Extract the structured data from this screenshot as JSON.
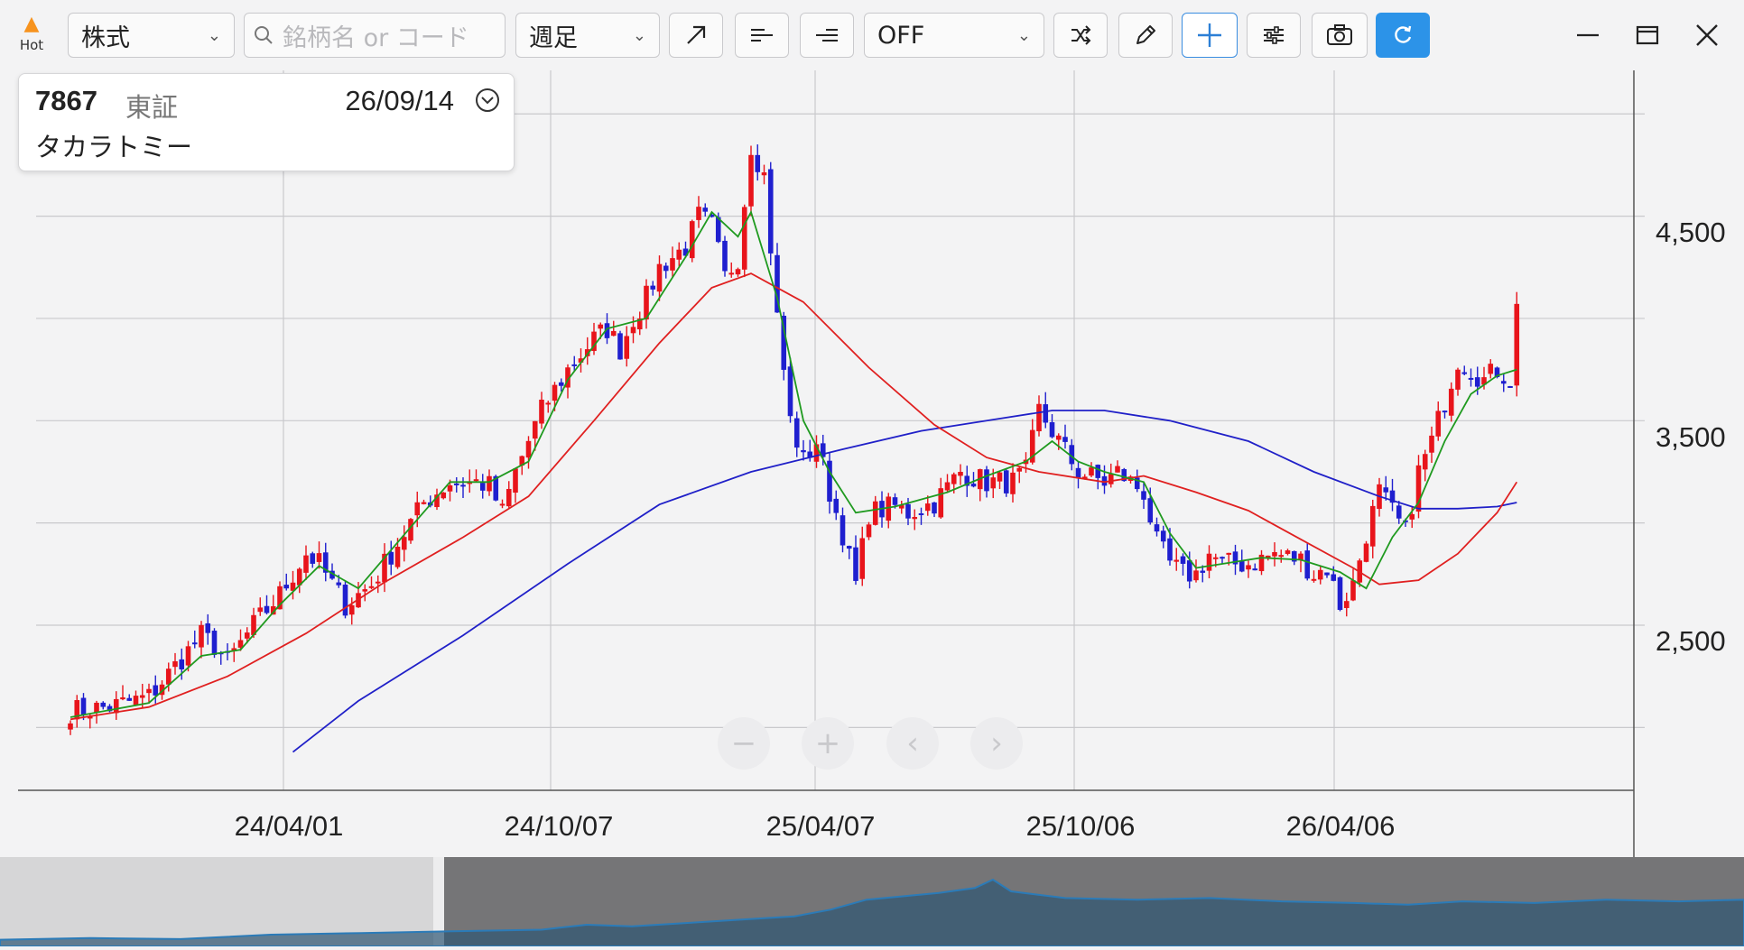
{
  "toolbar": {
    "hot_label": "Hot",
    "market_select": "株式",
    "search_placeholder": "銘柄名 or コード",
    "period_select": "週足",
    "indicator_select": "OFF",
    "icons": [
      "trend-line-icon",
      "horizontal-line-icon",
      "horizontal-line-right-icon",
      "shuffle-icon",
      "pencil-icon",
      "crosshair-icon",
      "settings-sliders-icon",
      "camera-icon",
      "refresh-icon"
    ],
    "window": [
      "minimize-icon",
      "maximize-icon",
      "close-icon"
    ]
  },
  "info_card": {
    "code": "7867",
    "exchange": "東証",
    "date": "26/09/14",
    "name": "タカラトミー"
  },
  "colors": {
    "up": "#e8141b",
    "down": "#1f1fcf",
    "ma_short": "#1f9a1f",
    "ma_mid": "#e02020",
    "ma_long": "#2020c8",
    "accent": "#2c93e8"
  },
  "chart_data": {
    "type": "candlestick",
    "x_ticks": [
      "24/04/01",
      "24/10/07",
      "25/04/07",
      "25/10/06",
      "26/04/06"
    ],
    "y_ticks": [
      "4,500",
      "3,500",
      "2,500"
    ],
    "ylim": [
      1960,
      5020
    ],
    "grid": true,
    "close_path": [
      [
        0,
        2080
      ],
      [
        6,
        2100
      ],
      [
        12,
        2150
      ],
      [
        16,
        2300
      ],
      [
        20,
        2450
      ],
      [
        22,
        2400
      ],
      [
        24,
        2320
      ],
      [
        28,
        2500
      ],
      [
        32,
        2650
      ],
      [
        36,
        2850
      ],
      [
        38,
        2800
      ],
      [
        41,
        2650
      ],
      [
        42,
        2600
      ],
      [
        46,
        2700
      ],
      [
        50,
        2900
      ],
      [
        54,
        3100
      ],
      [
        58,
        3200
      ],
      [
        62,
        3200
      ],
      [
        64,
        3180
      ],
      [
        66,
        3050
      ],
      [
        68,
        3250
      ],
      [
        72,
        3550
      ],
      [
        76,
        3750
      ],
      [
        80,
        3900
      ],
      [
        82,
        3950
      ],
      [
        84,
        3850
      ],
      [
        86,
        4000
      ],
      [
        88,
        4100
      ],
      [
        90,
        4250
      ],
      [
        94,
        4350
      ],
      [
        96,
        4500
      ],
      [
        98,
        4450
      ],
      [
        100,
        4200
      ],
      [
        102,
        4300
      ],
      [
        104,
        4850
      ],
      [
        106,
        4700
      ],
      [
        108,
        4000
      ],
      [
        110,
        3500
      ],
      [
        112,
        3300
      ],
      [
        114,
        3400
      ],
      [
        116,
        3150
      ],
      [
        118,
        2950
      ],
      [
        120,
        2700
      ],
      [
        122,
        3050
      ],
      [
        126,
        3080
      ],
      [
        128,
        3050
      ],
      [
        132,
        3100
      ],
      [
        136,
        3250
      ],
      [
        140,
        3200
      ],
      [
        144,
        3200
      ],
      [
        146,
        3250
      ],
      [
        148,
        3550
      ],
      [
        150,
        3450
      ],
      [
        152,
        3350
      ],
      [
        154,
        3250
      ],
      [
        158,
        3200
      ],
      [
        160,
        3250
      ],
      [
        164,
        3150
      ],
      [
        166,
        2900
      ],
      [
        168,
        2800
      ],
      [
        170,
        2750
      ],
      [
        172,
        2750
      ],
      [
        174,
        2850
      ],
      [
        176,
        2800
      ],
      [
        180,
        2800
      ],
      [
        184,
        2850
      ],
      [
        188,
        2820
      ],
      [
        190,
        2750
      ],
      [
        192,
        2780
      ],
      [
        194,
        2600
      ],
      [
        196,
        2700
      ],
      [
        198,
        2950
      ],
      [
        200,
        3150
      ],
      [
        202,
        3050
      ],
      [
        204,
        2950
      ],
      [
        206,
        3250
      ],
      [
        208,
        3400
      ],
      [
        210,
        3600
      ],
      [
        212,
        3800
      ],
      [
        216,
        3700
      ],
      [
        218,
        3750
      ],
      [
        220,
        3700
      ],
      [
        221,
        4050
      ]
    ],
    "ma_short": [
      [
        0,
        2050
      ],
      [
        12,
        2120
      ],
      [
        20,
        2350
      ],
      [
        26,
        2380
      ],
      [
        32,
        2600
      ],
      [
        38,
        2790
      ],
      [
        44,
        2680
      ],
      [
        52,
        2980
      ],
      [
        58,
        3200
      ],
      [
        64,
        3200
      ],
      [
        70,
        3300
      ],
      [
        76,
        3700
      ],
      [
        82,
        3950
      ],
      [
        88,
        4000
      ],
      [
        94,
        4300
      ],
      [
        98,
        4520
      ],
      [
        102,
        4400
      ],
      [
        104,
        4520
      ],
      [
        108,
        4100
      ],
      [
        112,
        3500
      ],
      [
        116,
        3250
      ],
      [
        120,
        3050
      ],
      [
        126,
        3080
      ],
      [
        134,
        3150
      ],
      [
        140,
        3230
      ],
      [
        146,
        3300
      ],
      [
        150,
        3400
      ],
      [
        154,
        3300
      ],
      [
        158,
        3250
      ],
      [
        164,
        3200
      ],
      [
        168,
        2950
      ],
      [
        172,
        2780
      ],
      [
        176,
        2800
      ],
      [
        182,
        2830
      ],
      [
        188,
        2820
      ],
      [
        194,
        2760
      ],
      [
        198,
        2680
      ],
      [
        202,
        2930
      ],
      [
        206,
        3100
      ],
      [
        210,
        3400
      ],
      [
        214,
        3630
      ],
      [
        218,
        3720
      ],
      [
        221,
        3750
      ]
    ],
    "ma_mid": [
      [
        0,
        2040
      ],
      [
        12,
        2100
      ],
      [
        24,
        2250
      ],
      [
        36,
        2460
      ],
      [
        48,
        2710
      ],
      [
        60,
        2930
      ],
      [
        70,
        3130
      ],
      [
        80,
        3500
      ],
      [
        90,
        3880
      ],
      [
        98,
        4150
      ],
      [
        104,
        4220
      ],
      [
        112,
        4080
      ],
      [
        122,
        3760
      ],
      [
        132,
        3480
      ],
      [
        140,
        3320
      ],
      [
        148,
        3250
      ],
      [
        158,
        3200
      ],
      [
        164,
        3230
      ],
      [
        172,
        3150
      ],
      [
        180,
        3060
      ],
      [
        188,
        2920
      ],
      [
        196,
        2780
      ],
      [
        200,
        2700
      ],
      [
        206,
        2720
      ],
      [
        212,
        2850
      ],
      [
        218,
        3050
      ],
      [
        221,
        3200
      ]
    ],
    "ma_long": [
      [
        34,
        1880
      ],
      [
        44,
        2130
      ],
      [
        60,
        2450
      ],
      [
        76,
        2800
      ],
      [
        90,
        3090
      ],
      [
        104,
        3250
      ],
      [
        118,
        3360
      ],
      [
        130,
        3450
      ],
      [
        142,
        3510
      ],
      [
        150,
        3550
      ],
      [
        158,
        3550
      ],
      [
        168,
        3500
      ],
      [
        180,
        3400
      ],
      [
        190,
        3250
      ],
      [
        200,
        3130
      ],
      [
        206,
        3070
      ],
      [
        212,
        3070
      ],
      [
        218,
        3080
      ],
      [
        221,
        3100
      ]
    ]
  }
}
